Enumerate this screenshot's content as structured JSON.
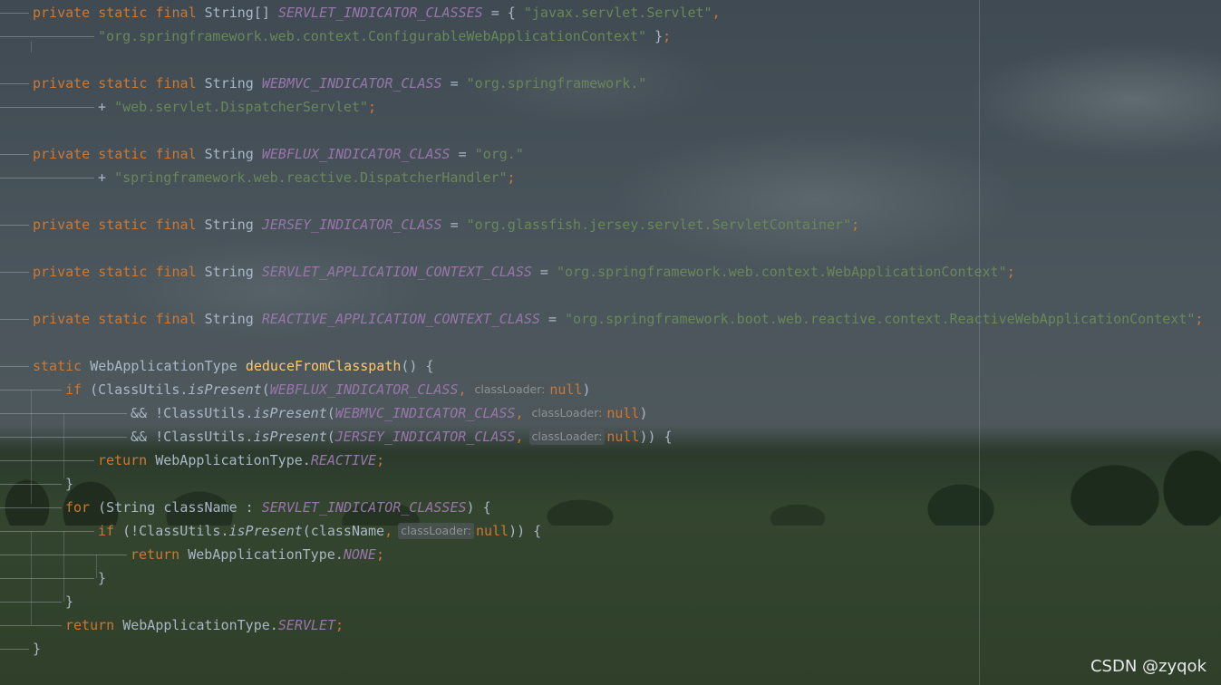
{
  "editor": {
    "lines": [
      [
        {
          "c": "kw",
          "t": "private static final "
        },
        {
          "c": "plain",
          "t": "String[] "
        },
        {
          "c": "const",
          "t": "SERVLET_INDICATOR_CLASSES"
        },
        {
          "c": "plain",
          "t": " = { "
        },
        {
          "c": "str",
          "t": "\"javax.servlet.Servlet\""
        },
        {
          "c": "kw",
          "t": ","
        }
      ],
      [
        {
          "c": "str",
          "t": "\"org.springframework.web.context.ConfigurableWebApplicationContext\""
        },
        {
          "c": "plain",
          "t": " }"
        },
        {
          "c": "kw",
          "t": ";"
        }
      ],
      [],
      [
        {
          "c": "kw",
          "t": "private static final "
        },
        {
          "c": "plain",
          "t": "String "
        },
        {
          "c": "const",
          "t": "WEBMVC_INDICATOR_CLASS"
        },
        {
          "c": "plain",
          "t": " = "
        },
        {
          "c": "str",
          "t": "\"org.springframework.\""
        }
      ],
      [
        {
          "c": "plain",
          "t": "+ "
        },
        {
          "c": "str",
          "t": "\"web.servlet.DispatcherServlet\""
        },
        {
          "c": "kw",
          "t": ";"
        }
      ],
      [],
      [
        {
          "c": "kw",
          "t": "private static final "
        },
        {
          "c": "plain",
          "t": "String "
        },
        {
          "c": "const",
          "t": "WEBFLUX_INDICATOR_CLASS"
        },
        {
          "c": "plain",
          "t": " = "
        },
        {
          "c": "str",
          "t": "\"org.\""
        }
      ],
      [
        {
          "c": "plain",
          "t": "+ "
        },
        {
          "c": "str",
          "t": "\"springframework.web.reactive.DispatcherHandler\""
        },
        {
          "c": "kw",
          "t": ";"
        }
      ],
      [],
      [
        {
          "c": "kw",
          "t": "private static final "
        },
        {
          "c": "plain",
          "t": "String "
        },
        {
          "c": "const",
          "t": "JERSEY_INDICATOR_CLASS"
        },
        {
          "c": "plain",
          "t": " = "
        },
        {
          "c": "str",
          "t": "\"org.glassfish.jersey.servlet.ServletContainer\""
        },
        {
          "c": "kw",
          "t": ";"
        }
      ],
      [],
      [
        {
          "c": "kw",
          "t": "private static final "
        },
        {
          "c": "plain",
          "t": "String "
        },
        {
          "c": "const",
          "t": "SERVLET_APPLICATION_CONTEXT_CLASS"
        },
        {
          "c": "plain",
          "t": " = "
        },
        {
          "c": "str",
          "t": "\"org.springframework.web.context.WebApplicationContext\""
        },
        {
          "c": "kw",
          "t": ";"
        }
      ],
      [],
      [
        {
          "c": "kw",
          "t": "private static final "
        },
        {
          "c": "plain",
          "t": "String "
        },
        {
          "c": "const",
          "t": "REACTIVE_APPLICATION_CONTEXT_CLASS"
        },
        {
          "c": "plain",
          "t": " = "
        },
        {
          "c": "str",
          "t": "\"org.springframework.boot.web.reactive.context.ReactiveWebApplicationContext\""
        },
        {
          "c": "kw",
          "t": ";"
        }
      ],
      [],
      [
        {
          "c": "kw",
          "t": "static "
        },
        {
          "c": "plain",
          "t": "WebApplicationType "
        },
        {
          "c": "fn",
          "t": "deduceFromClasspath"
        },
        {
          "c": "plain",
          "t": "() {"
        }
      ],
      [
        {
          "c": "kw",
          "t": "if "
        },
        {
          "c": "plain",
          "t": "(ClassUtils."
        },
        {
          "c": "it",
          "t": "isPresent"
        },
        {
          "c": "plain",
          "t": "("
        },
        {
          "c": "const",
          "t": "WEBFLUX_INDICATOR_CLASS"
        },
        {
          "c": "kw",
          "t": ","
        },
        {
          "c": "hint",
          "t": "classLoader:"
        },
        {
          "c": "kw",
          "t": "null"
        },
        {
          "c": "plain",
          "t": ")"
        }
      ],
      [
        {
          "c": "plain",
          "t": "&& !ClassUtils."
        },
        {
          "c": "it",
          "t": "isPresent"
        },
        {
          "c": "plain",
          "t": "("
        },
        {
          "c": "const",
          "t": "WEBMVC_INDICATOR_CLASS"
        },
        {
          "c": "kw",
          "t": ","
        },
        {
          "c": "hint",
          "t": "classLoader:"
        },
        {
          "c": "kw",
          "t": "null"
        },
        {
          "c": "plain",
          "t": ")"
        }
      ],
      [
        {
          "c": "plain",
          "t": "&& !ClassUtils."
        },
        {
          "c": "it",
          "t": "isPresent"
        },
        {
          "c": "plain",
          "t": "("
        },
        {
          "c": "const",
          "t": "JERSEY_INDICATOR_CLASS"
        },
        {
          "c": "kw",
          "t": ","
        },
        {
          "c": "hint",
          "t": "classLoader:"
        },
        {
          "c": "kw",
          "t": "null"
        },
        {
          "c": "plain",
          "t": ")) {"
        }
      ],
      [
        {
          "c": "kw",
          "t": "return "
        },
        {
          "c": "plain",
          "t": "WebApplicationType."
        },
        {
          "c": "const",
          "t": "REACTIVE"
        },
        {
          "c": "kw",
          "t": ";"
        }
      ],
      [
        {
          "c": "plain",
          "t": "}"
        }
      ],
      [
        {
          "c": "kw",
          "t": "for "
        },
        {
          "c": "plain",
          "t": "(String className : "
        },
        {
          "c": "const",
          "t": "SERVLET_INDICATOR_CLASSES"
        },
        {
          "c": "plain",
          "t": ") {"
        }
      ],
      [
        {
          "c": "kw",
          "t": "if "
        },
        {
          "c": "plain",
          "t": "(!ClassUtils."
        },
        {
          "c": "it",
          "t": "isPresent"
        },
        {
          "c": "plain",
          "t": "(className"
        },
        {
          "c": "kw",
          "t": ","
        },
        {
          "c": "hint",
          "t": "classLoader:"
        },
        {
          "c": "kw",
          "t": "null"
        },
        {
          "c": "plain",
          "t": ")) {"
        }
      ],
      [
        {
          "c": "kw",
          "t": "return "
        },
        {
          "c": "plain",
          "t": "WebApplicationType."
        },
        {
          "c": "const",
          "t": "NONE"
        },
        {
          "c": "kw",
          "t": ";"
        }
      ],
      [
        {
          "c": "plain",
          "t": "}"
        }
      ],
      [
        {
          "c": "plain",
          "t": "}"
        }
      ],
      [
        {
          "c": "kw",
          "t": "return "
        },
        {
          "c": "plain",
          "t": "WebApplicationType."
        },
        {
          "c": "const",
          "t": "SERVLET"
        },
        {
          "c": "kw",
          "t": ";"
        }
      ],
      [
        {
          "c": "plain",
          "t": "}"
        }
      ]
    ]
  },
  "watermark": "CSDN @zyqok",
  "colors": {
    "keyword": "#cc7832",
    "string": "#6a8759",
    "constant": "#9876aa",
    "method": "#ffc66d",
    "text": "#a9b7c6"
  }
}
